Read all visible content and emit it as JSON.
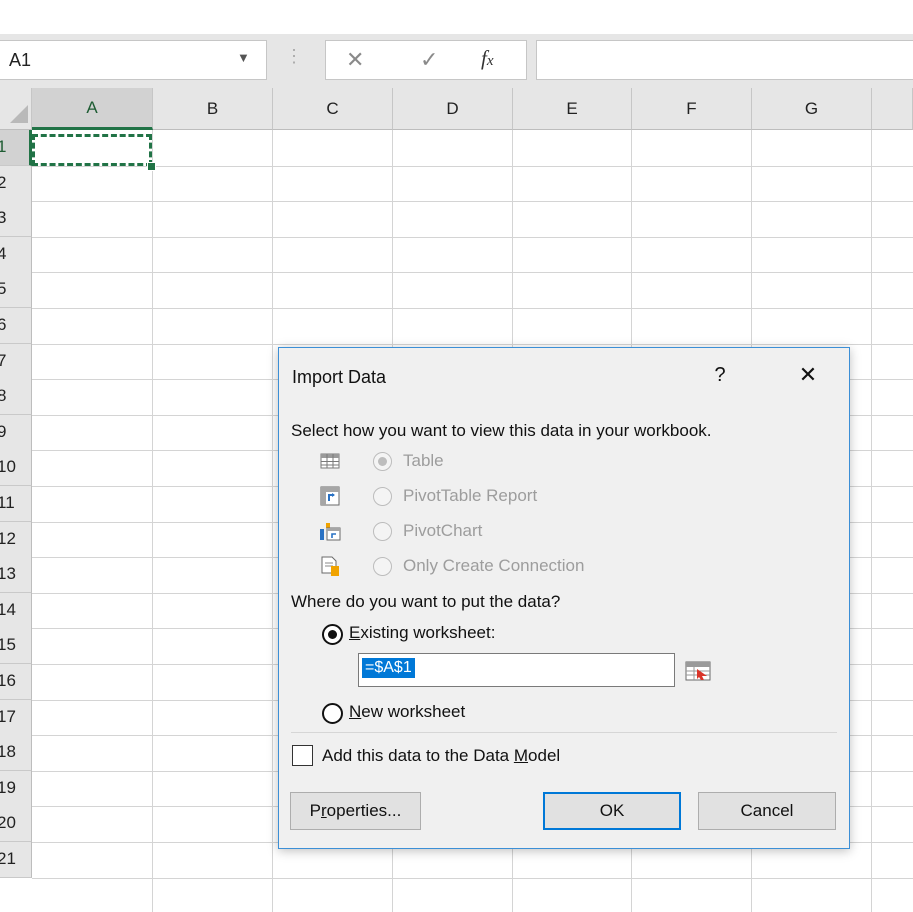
{
  "formula_bar": {
    "name_box": "A1",
    "fx_label": "fx",
    "formula_value": ""
  },
  "grid": {
    "columns": [
      "A",
      "B",
      "C",
      "D",
      "E",
      "F",
      "G"
    ],
    "rows": [
      "1",
      "2",
      "3",
      "4",
      "5",
      "6",
      "7",
      "8",
      "9",
      "10",
      "11",
      "12",
      "13",
      "14",
      "15",
      "16",
      "17",
      "18",
      "19",
      "20",
      "21"
    ],
    "selected_cell": "A1"
  },
  "dialog": {
    "title": "Import Data",
    "help": "?",
    "close": "✕",
    "prompt_view": "Select how you want to view this data in your workbook.",
    "view_options": [
      {
        "label": "Table",
        "icon": "table-icon",
        "selected": true,
        "enabled": false
      },
      {
        "label": "PivotTable Report",
        "icon": "pivottable-icon",
        "selected": false,
        "enabled": false
      },
      {
        "label": "PivotChart",
        "icon": "pivotchart-icon",
        "selected": false,
        "enabled": false
      },
      {
        "label": "Only Create Connection",
        "icon": "connection-icon",
        "selected": false,
        "enabled": false
      }
    ],
    "prompt_location": "Where do you want to put the data?",
    "existing_worksheet": "Existing worksheet:",
    "existing_mnemonic": "E",
    "existing_rest": "xisting worksheet:",
    "range_value": "=$A$1",
    "new_worksheet_mnemonic": "N",
    "new_worksheet_rest": "ew worksheet",
    "data_model_pre": "Add this data to the Data ",
    "data_model_mnemonic": "M",
    "data_model_post": "odel",
    "data_model_checked": false,
    "properties_pre": "P",
    "properties_mnemonic": "r",
    "properties_post": "operties...",
    "ok_label": "OK",
    "cancel_label": "Cancel",
    "accent_color": "#0078d7",
    "excel_green": "#217346"
  }
}
